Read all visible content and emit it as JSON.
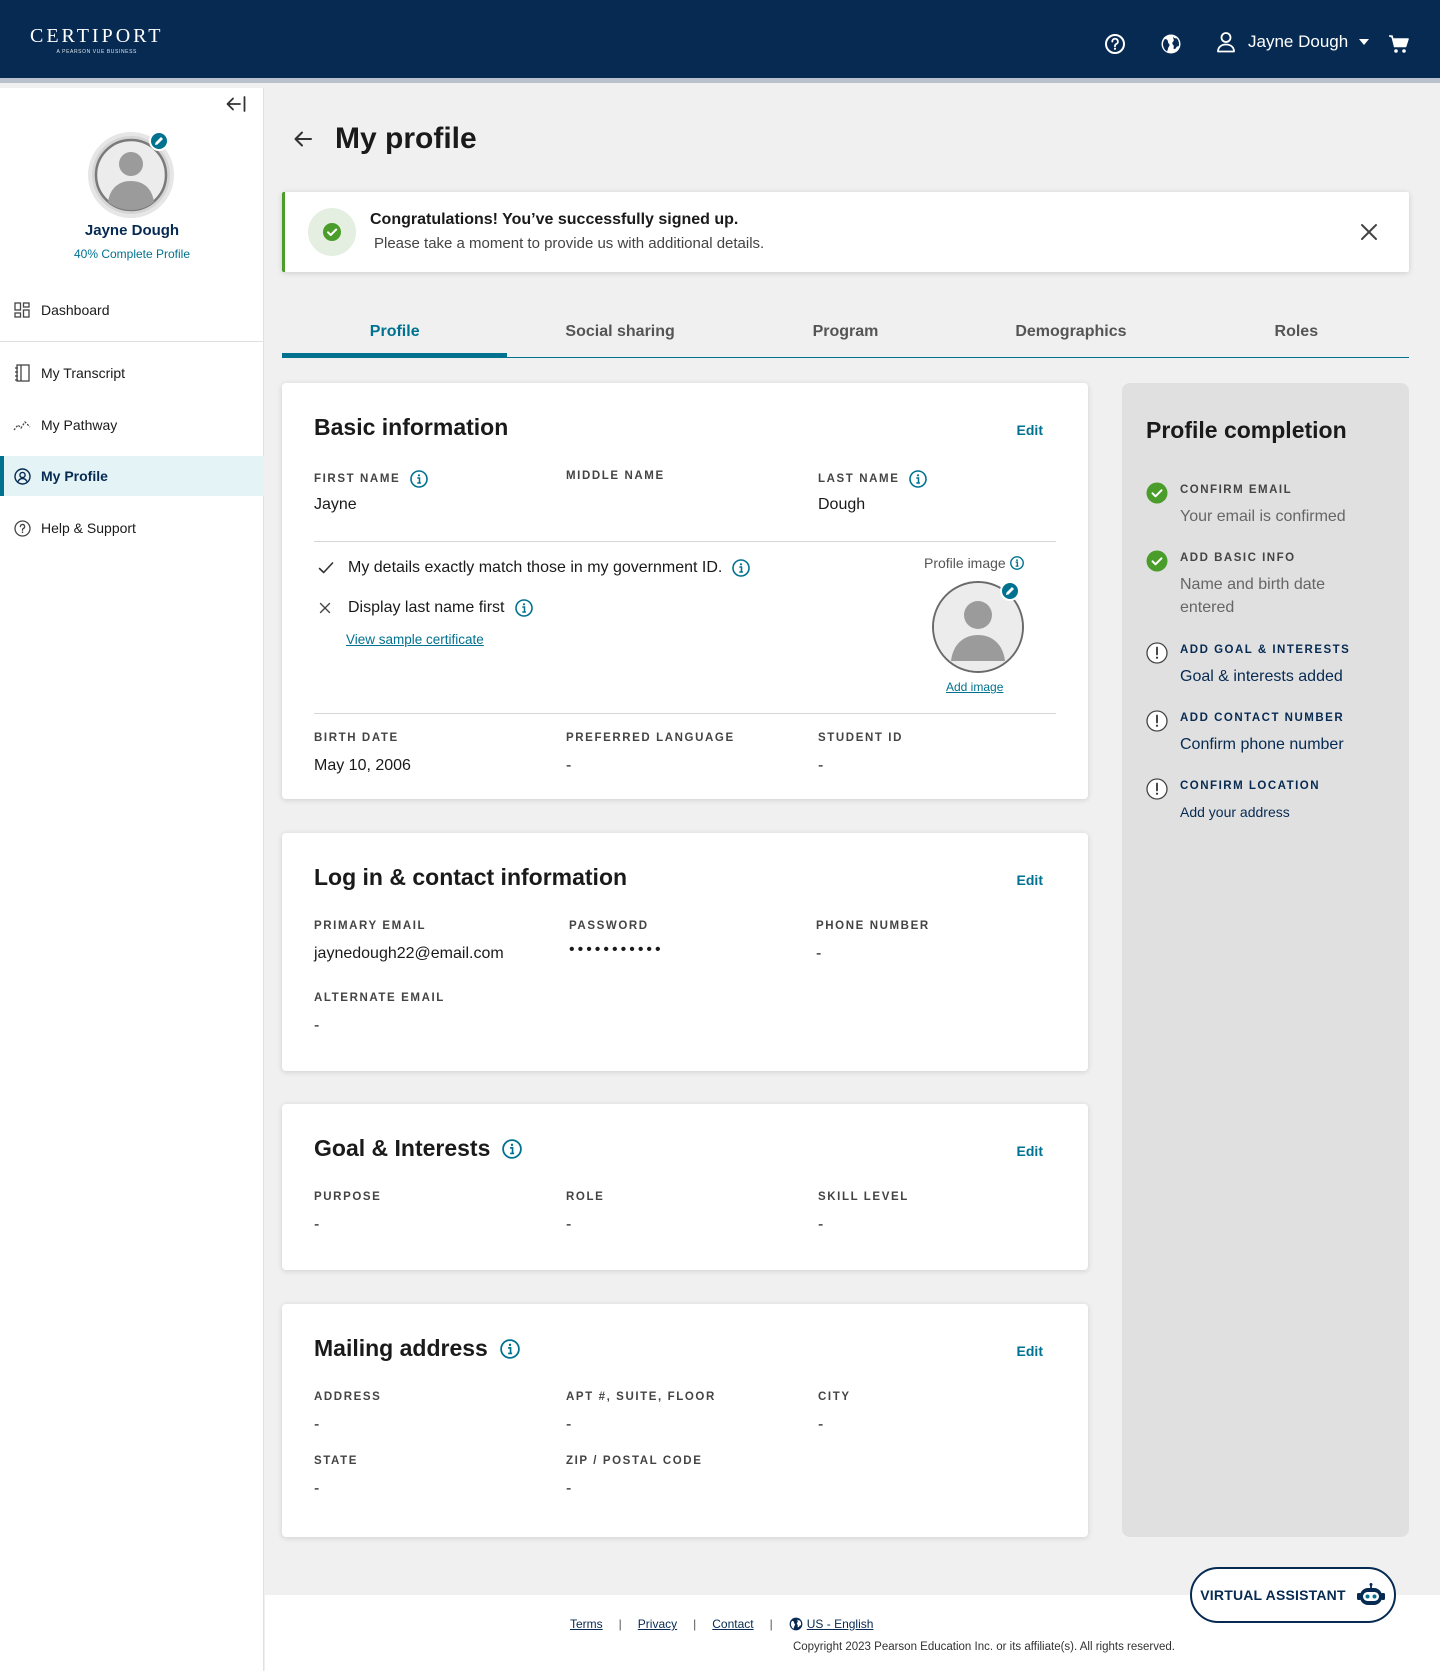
{
  "header": {
    "logo_text": "CERTIPORT",
    "logo_subtitle": "A PEARSON VUE BUSINESS",
    "user_name": "Jayne Dough"
  },
  "sidebar": {
    "user_name": "Jayne Dough",
    "completion_text": "40% Complete Profile",
    "items": [
      {
        "label": "Dashboard",
        "icon": "dashboard-icon"
      },
      {
        "label": "My Transcript",
        "icon": "transcript-icon"
      },
      {
        "label": "My Pathway",
        "icon": "pathway-icon"
      },
      {
        "label": "My Profile",
        "icon": "profile-icon",
        "active": true
      },
      {
        "label": "Help & Support",
        "icon": "help-icon"
      }
    ]
  },
  "page": {
    "title": "My profile"
  },
  "alert": {
    "title": "Congratulations! You’ve successfully signed up.",
    "message": "Please take a moment to provide us with additional details."
  },
  "tabs": [
    {
      "label": "Profile",
      "active": true
    },
    {
      "label": "Social sharing"
    },
    {
      "label": "Program"
    },
    {
      "label": "Demographics"
    },
    {
      "label": "Roles"
    }
  ],
  "basic_info": {
    "title": "Basic information",
    "edit_label": "Edit",
    "first_name_label": "FIRST NAME",
    "first_name": "Jayne",
    "middle_name_label": "MIDDLE NAME",
    "middle_name": "",
    "last_name_label": "LAST NAME",
    "last_name": "Dough",
    "gov_id_text": "My details exactly match those in my government ID.",
    "last_first_text": "Display last name first",
    "sample_link": "View sample certificate",
    "profile_image_label": "Profile image",
    "add_image_link": "Add image",
    "birth_date_label": "BIRTH DATE",
    "birth_date": "May 10, 2006",
    "language_label": "PREFERRED LANGUAGE",
    "language": "-",
    "student_id_label": "STUDENT ID",
    "student_id": "-"
  },
  "contact_info": {
    "title": "Log in & contact information",
    "edit_label": "Edit",
    "email_label": "PRIMARY EMAIL",
    "email": "jaynedough22@email.com",
    "password_label": "PASSWORD",
    "password": "•••••••••••",
    "phone_label": "PHONE NUMBER",
    "phone": "-",
    "alt_email_label": "ALTERNATE EMAIL",
    "alt_email": "-"
  },
  "goals": {
    "title": "Goal & Interests",
    "edit_label": "Edit",
    "purpose_label": "PURPOSE",
    "purpose": "-",
    "role_label": "ROLE",
    "role": "-",
    "skill_label": "SKILL LEVEL",
    "skill": "-"
  },
  "mailing": {
    "title": "Mailing address",
    "edit_label": "Edit",
    "address_label": "ADDRESS",
    "address": "-",
    "apt_label": "APT #, SUITE, FLOOR",
    "apt": "-",
    "city_label": "CITY",
    "city": "-",
    "state_label": "STATE",
    "state": "-",
    "zip_label": "ZIP / POSTAL CODE",
    "zip": "-"
  },
  "completion": {
    "title": "Profile completion",
    "items": [
      {
        "label": "CONFIRM EMAIL",
        "desc": "Your email is confirmed",
        "status": "done"
      },
      {
        "label": "ADD BASIC INFO",
        "desc": "Name  and birth date entered",
        "status": "done"
      },
      {
        "label": "ADD GOAL & INTERESTS",
        "desc": "Goal & interests added",
        "status": "todo"
      },
      {
        "label": "ADD CONTACT NUMBER",
        "desc": "Confirm phone number",
        "status": "todo"
      },
      {
        "label": "CONFIRM LOCATION",
        "desc": "Add your address",
        "status": "todo"
      }
    ]
  },
  "footer": {
    "terms": "Terms",
    "privacy": "Privacy",
    "contact": "Contact",
    "language": "US - English",
    "copyright": "Copyright 2023 Pearson Education Inc. or its affiliate(s). All rights reserved."
  },
  "virtual_assistant": {
    "label": "VIRTUAL ASSISTANT"
  },
  "colors": {
    "header_bg": "#062a52",
    "accent": "#007290",
    "success": "#4a9d2a"
  }
}
